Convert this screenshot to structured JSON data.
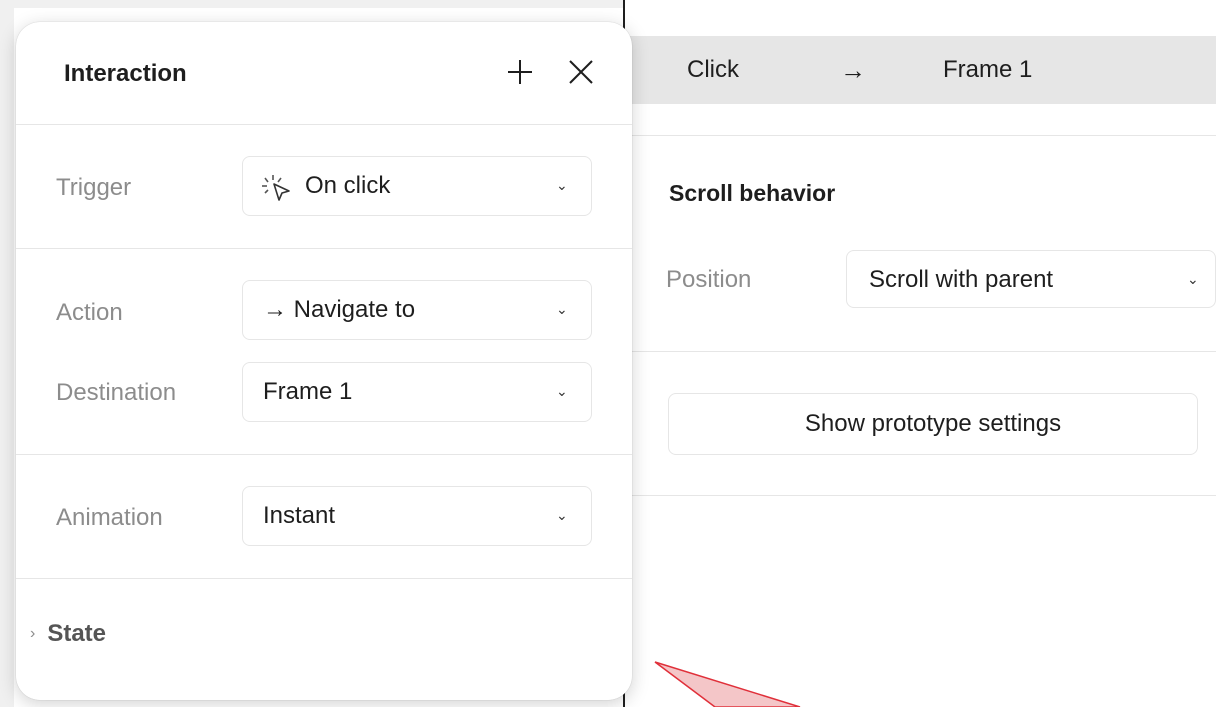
{
  "interaction_summary": {
    "trigger": "Click",
    "arrow": "→",
    "destination": "Frame 1"
  },
  "scroll_behavior": {
    "title": "Scroll behavior",
    "position_label": "Position",
    "position_value": "Scroll with parent"
  },
  "prototype_button": "Show prototype settings",
  "popover": {
    "title": "Interaction",
    "add_icon": "plus-icon",
    "close_icon": "close-icon",
    "trigger": {
      "label": "Trigger",
      "value": "On click",
      "icon": "click-cursor-icon"
    },
    "action": {
      "label": "Action",
      "value": "→ Navigate to"
    },
    "destination": {
      "label": "Destination",
      "value": "Frame 1"
    },
    "animation": {
      "label": "Animation",
      "value": "Instant"
    },
    "state": {
      "label": "State"
    }
  },
  "colors": {
    "annotation_fill": "#f4c6c8",
    "annotation_stroke": "#e0303a"
  }
}
